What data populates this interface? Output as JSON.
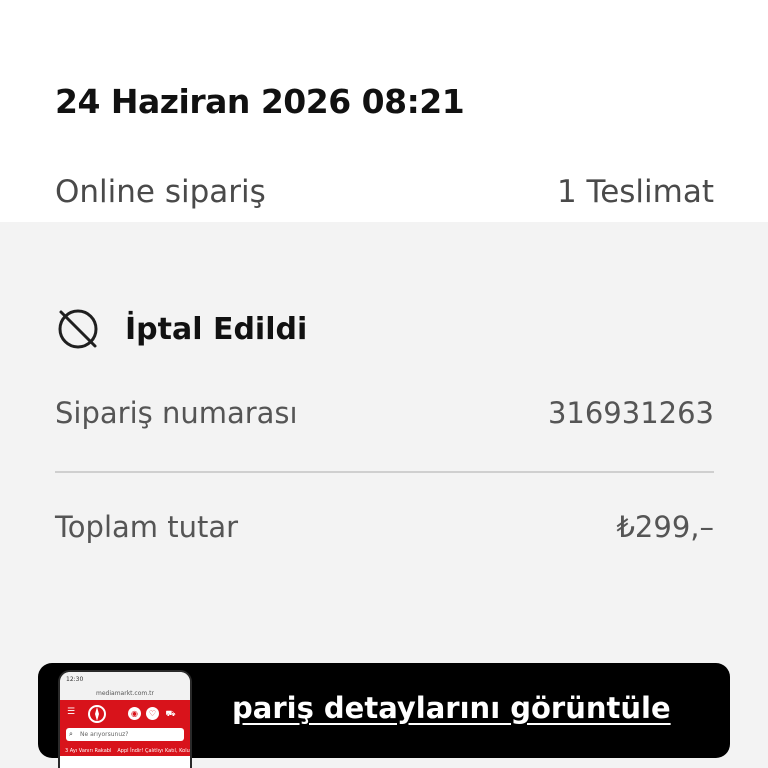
{
  "order": {
    "date": "24 Haziran 2026 08:21",
    "type": "Online sipariş",
    "deliveries": "1 Teslimat"
  },
  "status": {
    "icon": "cancelled-icon",
    "label": "İptal Edildi"
  },
  "details": {
    "order_number_label": "Sipariş numarası",
    "order_number_value": "316931263",
    "total_label": "Toplam tutar",
    "total_value": "₺299,–"
  },
  "cta": {
    "label": "pariş detaylarını görüntüle"
  },
  "thumbnail": {
    "time": "12:30",
    "url": "mediamarkt.com.tr",
    "search_placeholder": "Ne arıyorsunuz?",
    "promo_1": "3 Ayı Vanırı Rakabl",
    "promo_2": "Appl İndir! Çalıtlıyı Katıl, Kolul"
  },
  "colors": {
    "brand_red": "#d8131b",
    "card_bg": "#f3f3f3",
    "button_bg": "#000000"
  }
}
